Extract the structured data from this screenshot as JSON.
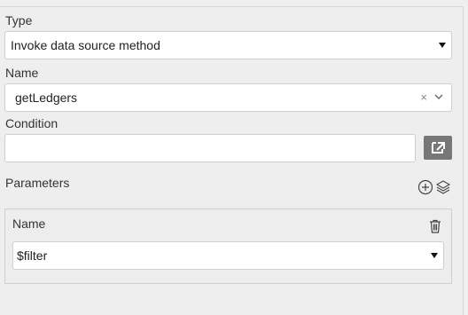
{
  "type": {
    "label": "Type",
    "value": "Invoke data source method"
  },
  "name": {
    "label": "Name",
    "value": "getLedgers",
    "clear_glyph": "×"
  },
  "condition": {
    "label": "Condition",
    "value": ""
  },
  "parameters": {
    "label": "Parameters",
    "items": [
      {
        "label": "Name",
        "value": "$filter"
      }
    ]
  },
  "icons": {
    "external": "external-link-icon",
    "add": "add-circle-icon",
    "layers": "layers-icon",
    "delete": "trash-icon",
    "caret": "caret-down-icon",
    "chevron": "chevron-down-icon"
  },
  "colors": {
    "background": "#eeeeee",
    "field_bg": "#ffffff",
    "button_bg": "#777777"
  }
}
